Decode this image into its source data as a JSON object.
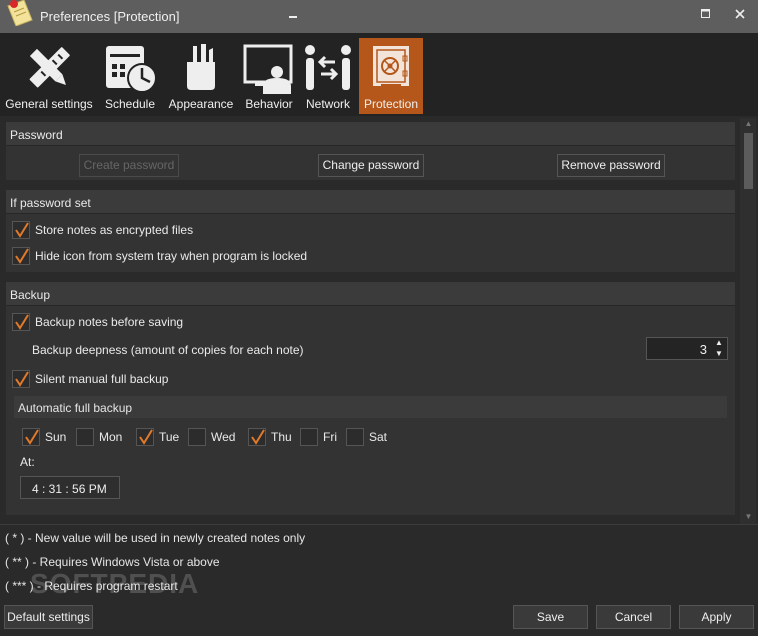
{
  "window": {
    "title": "Preferences [Protection]",
    "minimize_icon": "minimize-icon",
    "maximize_icon": "maximize-icon",
    "close_icon": "close-icon"
  },
  "toolbar": {
    "active_color": "#b5571a",
    "items": [
      {
        "label": "General settings",
        "icon": "pencil-ruler-icon"
      },
      {
        "label": "Schedule",
        "icon": "calendar-clock-icon"
      },
      {
        "label": "Appearance",
        "icon": "brushes-cup-icon"
      },
      {
        "label": "Behavior",
        "icon": "presentation-monitor-icon"
      },
      {
        "label": "Network",
        "icon": "people-exchange-icon"
      },
      {
        "label": "Protection",
        "icon": "safe-icon",
        "active": true
      }
    ]
  },
  "password": {
    "header": "Password",
    "create_label": "Create password",
    "create_disabled": true,
    "change_label": "Change password",
    "remove_label": "Remove password"
  },
  "if_password_set": {
    "header": "If password set",
    "options": [
      {
        "label": "Store notes as encrypted files",
        "checked": true
      },
      {
        "label": "Hide icon from system tray when program is locked",
        "checked": true
      }
    ]
  },
  "backup": {
    "header": "Backup",
    "backup_before_saving": {
      "label": "Backup notes before saving",
      "checked": true
    },
    "deepness_label": "Backup deepness (amount of copies for each note)",
    "deepness_value": "3",
    "silent_manual": {
      "label": "Silent manual full backup",
      "checked": true
    },
    "automatic_header": "Automatic full backup",
    "days": [
      {
        "label": "Sun",
        "checked": true
      },
      {
        "label": "Mon",
        "checked": false
      },
      {
        "label": "Tue",
        "checked": true
      },
      {
        "label": "Wed",
        "checked": false
      },
      {
        "label": "Thu",
        "checked": true
      },
      {
        "label": "Fri",
        "checked": false
      },
      {
        "label": "Sat",
        "checked": false
      }
    ],
    "at_label": "At:",
    "time_value": "4 : 31 : 56   PM"
  },
  "notes": [
    "( * ) - New value will be used in newly created notes only",
    "( ** ) - Requires Windows Vista or above",
    "( *** ) - Requires program restart"
  ],
  "watermark": "SOFTPEDIA",
  "footer": {
    "default_label": "Default settings",
    "save_label": "Save",
    "cancel_label": "Cancel",
    "apply_label": "Apply"
  },
  "check_color": "#e07a2a"
}
